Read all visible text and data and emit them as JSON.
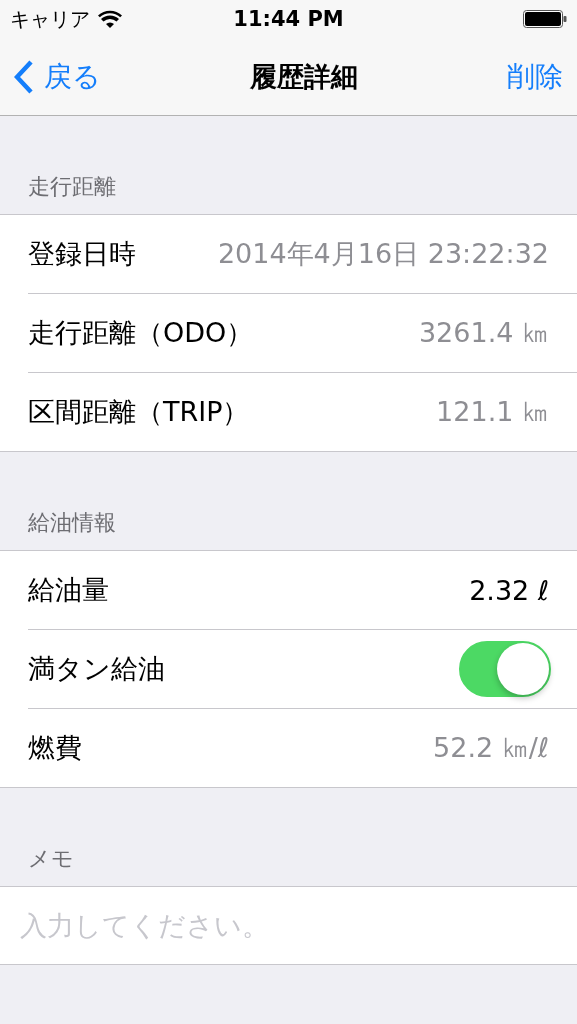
{
  "status_bar": {
    "carrier": "キャリア",
    "time": "11:44 PM"
  },
  "nav": {
    "back": "戻る",
    "title": "履歴詳細",
    "action": "削除"
  },
  "sections": [
    {
      "header": "走行距離",
      "rows": [
        {
          "kind": "value",
          "label": "登録日時",
          "value": "2014年4月16日 23:22:32"
        },
        {
          "kind": "value",
          "label": "走行距離（ODO）",
          "value": "3261.4 ㎞"
        },
        {
          "kind": "value",
          "label": "区間距離（TRIP）",
          "value": "121.1 ㎞"
        }
      ]
    },
    {
      "header": "給油情報",
      "rows": [
        {
          "kind": "input",
          "label": "給油量",
          "value": "2.32 ℓ"
        },
        {
          "kind": "switch",
          "label": "満タン給油",
          "on": true
        },
        {
          "kind": "value",
          "label": "燃費",
          "value": "52.2 ㎞/ℓ"
        }
      ]
    }
  ],
  "memo": {
    "header": "メモ",
    "placeholder": "入力してください。"
  }
}
